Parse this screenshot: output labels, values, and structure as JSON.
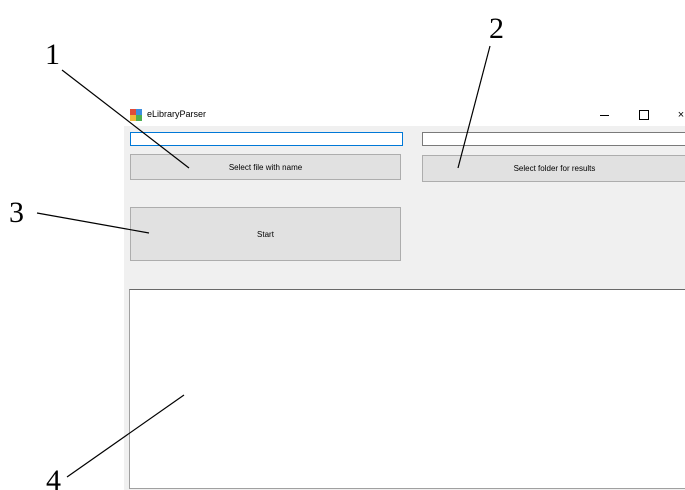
{
  "window": {
    "title": "eLibraryParser",
    "minimize_label": "–",
    "maximize_label": "",
    "close_label": "×"
  },
  "file_input": {
    "value": ""
  },
  "folder_input": {
    "value": ""
  },
  "buttons": {
    "select_file": "Select file with name",
    "select_folder": "Select folder for results",
    "start": "Start"
  },
  "output": {
    "text": ""
  },
  "callouts": [
    "1",
    "2",
    "3",
    "4"
  ],
  "icons": {
    "app": "app-icon",
    "minimize": "minimize-icon",
    "maximize": "maximize-icon",
    "close": "close-icon"
  }
}
